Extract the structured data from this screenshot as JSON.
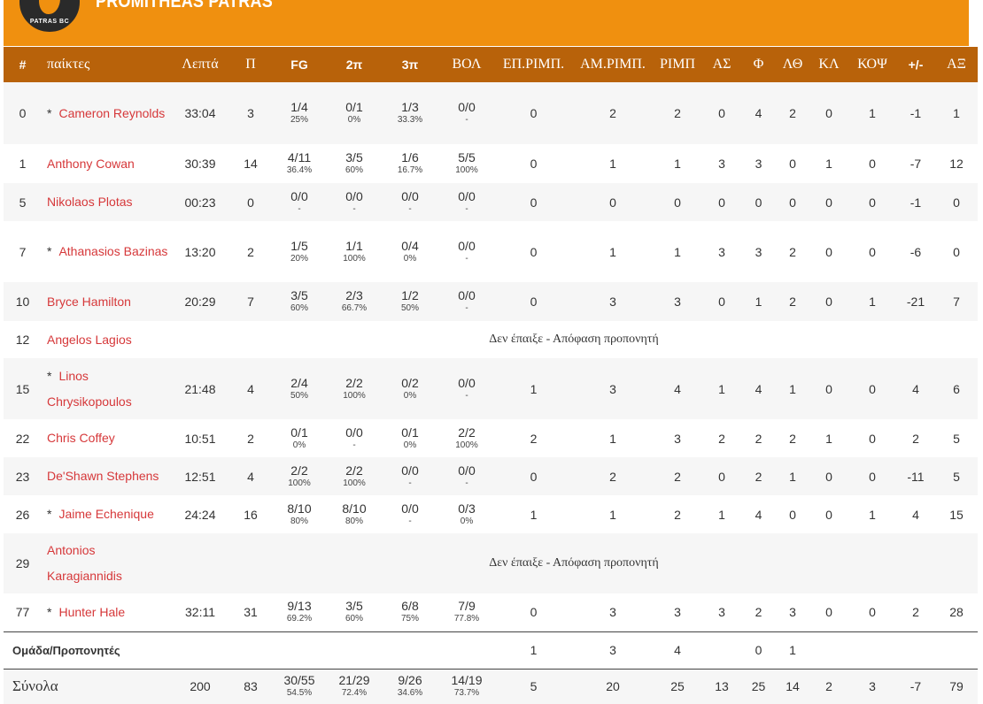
{
  "team": {
    "name": "PROMITHEAS PATRAS",
    "logo_text": "PATRAS BC",
    "accent": "#f0900f",
    "header_dark": "#b8620a",
    "link_color": "#d6383a"
  },
  "table": {
    "headers": [
      "#",
      "παίκτες",
      "Λεπτά",
      "Π",
      "FG",
      "2π",
      "3π",
      "ΒΟΛ",
      "ΕΠ.ΡΙΜΠ.",
      "ΑΜ.ΡΙΜΠ.",
      "ΡΙΜΠ",
      "ΑΣ",
      "Φ",
      "ΛΘ",
      "ΚΛ",
      "ΚΟΨ",
      "+/-",
      "ΑΞ"
    ],
    "players": [
      {
        "no": "0",
        "star": "*",
        "name": "Cameron Reynolds",
        "min": "33:04",
        "pts": "3",
        "fg": "1/4",
        "fg_pct": "25%",
        "p2": "0/1",
        "p2_pct": "0%",
        "p3": "1/3",
        "p3_pct": "33.3%",
        "ft": "0/0",
        "ft_pct": "-",
        "or": "0",
        "dr": "2",
        "reb": "2",
        "ast": "0",
        "pf": "4",
        "to": "2",
        "st": "0",
        "bl": "1",
        "pm": "-1",
        "eff": "1"
      },
      {
        "no": "1",
        "star": "",
        "name": "Anthony Cowan",
        "min": "30:39",
        "pts": "14",
        "fg": "4/11",
        "fg_pct": "36.4%",
        "p2": "3/5",
        "p2_pct": "60%",
        "p3": "1/6",
        "p3_pct": "16.7%",
        "ft": "5/5",
        "ft_pct": "100%",
        "or": "0",
        "dr": "1",
        "reb": "1",
        "ast": "3",
        "pf": "3",
        "to": "0",
        "st": "1",
        "bl": "0",
        "pm": "-7",
        "eff": "12"
      },
      {
        "no": "5",
        "star": "",
        "name": "Nikolaos Plotas",
        "min": "00:23",
        "pts": "0",
        "fg": "0/0",
        "fg_pct": "-",
        "p2": "0/0",
        "p2_pct": "-",
        "p3": "0/0",
        "p3_pct": "-",
        "ft": "0/0",
        "ft_pct": "-",
        "or": "0",
        "dr": "0",
        "reb": "0",
        "ast": "0",
        "pf": "0",
        "to": "0",
        "st": "0",
        "bl": "0",
        "pm": "-1",
        "eff": "0"
      },
      {
        "no": "7",
        "star": "*",
        "name": "Athanasios Bazinas",
        "min": "13:20",
        "pts": "2",
        "fg": "1/5",
        "fg_pct": "20%",
        "p2": "1/1",
        "p2_pct": "100%",
        "p3": "0/4",
        "p3_pct": "0%",
        "ft": "0/0",
        "ft_pct": "-",
        "or": "0",
        "dr": "1",
        "reb": "1",
        "ast": "3",
        "pf": "3",
        "to": "2",
        "st": "0",
        "bl": "0",
        "pm": "-6",
        "eff": "0"
      },
      {
        "no": "10",
        "star": "",
        "name": "Bryce Hamilton",
        "min": "20:29",
        "pts": "7",
        "fg": "3/5",
        "fg_pct": "60%",
        "p2": "2/3",
        "p2_pct": "66.7%",
        "p3": "1/2",
        "p3_pct": "50%",
        "ft": "0/0",
        "ft_pct": "-",
        "or": "0",
        "dr": "3",
        "reb": "3",
        "ast": "0",
        "pf": "1",
        "to": "2",
        "st": "0",
        "bl": "1",
        "pm": "-21",
        "eff": "7"
      },
      {
        "no": "12",
        "star": "",
        "name": "Angelos Lagios",
        "dnp": "Δεν έπαιξε - Απόφαση προπονητή"
      },
      {
        "no": "15",
        "star": "*",
        "name": "Linos Chrysikopoulos",
        "min": "21:48",
        "pts": "4",
        "fg": "2/4",
        "fg_pct": "50%",
        "p2": "2/2",
        "p2_pct": "100%",
        "p3": "0/2",
        "p3_pct": "0%",
        "ft": "0/0",
        "ft_pct": "-",
        "or": "1",
        "dr": "3",
        "reb": "4",
        "ast": "1",
        "pf": "4",
        "to": "1",
        "st": "0",
        "bl": "0",
        "pm": "4",
        "eff": "6"
      },
      {
        "no": "22",
        "star": "",
        "name": "Chris Coffey",
        "min": "10:51",
        "pts": "2",
        "fg": "0/1",
        "fg_pct": "0%",
        "p2": "0/0",
        "p2_pct": "-",
        "p3": "0/1",
        "p3_pct": "0%",
        "ft": "2/2",
        "ft_pct": "100%",
        "or": "2",
        "dr": "1",
        "reb": "3",
        "ast": "2",
        "pf": "2",
        "to": "2",
        "st": "1",
        "bl": "0",
        "pm": "2",
        "eff": "5"
      },
      {
        "no": "23",
        "star": "",
        "name": "De'Shawn Stephens",
        "min": "12:51",
        "pts": "4",
        "fg": "2/2",
        "fg_pct": "100%",
        "p2": "2/2",
        "p2_pct": "100%",
        "p3": "0/0",
        "p3_pct": "-",
        "ft": "0/0",
        "ft_pct": "-",
        "or": "0",
        "dr": "2",
        "reb": "2",
        "ast": "0",
        "pf": "2",
        "to": "1",
        "st": "0",
        "bl": "0",
        "pm": "-11",
        "eff": "5"
      },
      {
        "no": "26",
        "star": "*",
        "name": "Jaime Echenique",
        "min": "24:24",
        "pts": "16",
        "fg": "8/10",
        "fg_pct": "80%",
        "p2": "8/10",
        "p2_pct": "80%",
        "p3": "0/0",
        "p3_pct": "-",
        "ft": "0/3",
        "ft_pct": "0%",
        "or": "1",
        "dr": "1",
        "reb": "2",
        "ast": "1",
        "pf": "4",
        "to": "0",
        "st": "0",
        "bl": "1",
        "pm": "4",
        "eff": "15"
      },
      {
        "no": "29",
        "star": "",
        "name": "Antonios Karagiannidis",
        "dnp": "Δεν έπαιξε - Απόφαση προπονητή"
      },
      {
        "no": "77",
        "star": "*",
        "name": "Hunter Hale",
        "min": "32:11",
        "pts": "31",
        "fg": "9/13",
        "fg_pct": "69.2%",
        "p2": "3/5",
        "p2_pct": "60%",
        "p3": "6/8",
        "p3_pct": "75%",
        "ft": "7/9",
        "ft_pct": "77.8%",
        "or": "0",
        "dr": "3",
        "reb": "3",
        "ast": "3",
        "pf": "2",
        "to": "3",
        "st": "0",
        "bl": "0",
        "pm": "2",
        "eff": "28"
      }
    ],
    "team_row": {
      "label": "Ομάδα/Προπονητές",
      "or": "1",
      "dr": "3",
      "reb": "4",
      "ast": "",
      "pf": "0",
      "to": "1"
    },
    "totals": {
      "label": "Σύνολα",
      "min": "200",
      "pts": "83",
      "fg": "30/55",
      "fg_pct": "54.5%",
      "p2": "21/29",
      "p2_pct": "72.4%",
      "p3": "9/26",
      "p3_pct": "34.6%",
      "ft": "14/19",
      "ft_pct": "73.7%",
      "or": "5",
      "dr": "20",
      "reb": "25",
      "ast": "13",
      "pf": "25",
      "to": "14",
      "st": "2",
      "bl": "3",
      "pm": "-7",
      "eff": "79"
    }
  }
}
